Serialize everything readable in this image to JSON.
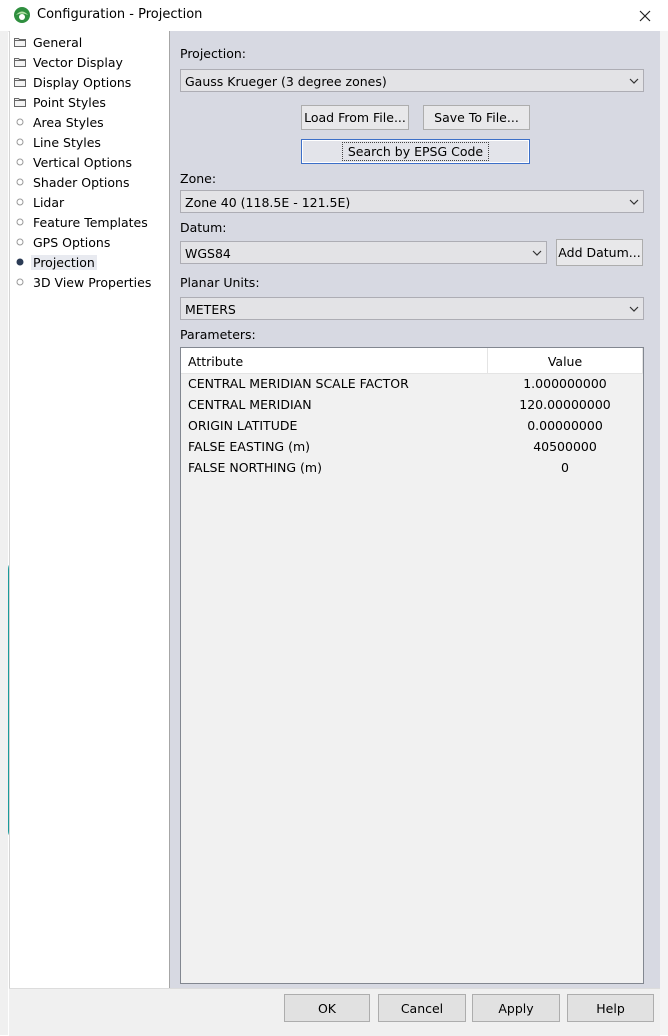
{
  "window": {
    "title": "Configuration - Projection"
  },
  "sidebar": {
    "items": [
      {
        "label": "General",
        "icon": "folder-icon"
      },
      {
        "label": "Vector Display",
        "icon": "folder-icon"
      },
      {
        "label": "Display Options",
        "icon": "folder-icon"
      },
      {
        "label": "Point Styles",
        "icon": "folder-icon"
      },
      {
        "label": "Area Styles",
        "icon": "circle-icon"
      },
      {
        "label": "Line Styles",
        "icon": "circle-icon"
      },
      {
        "label": "Vertical Options",
        "icon": "circle-icon"
      },
      {
        "label": "Shader Options",
        "icon": "circle-icon"
      },
      {
        "label": "Lidar",
        "icon": "circle-icon"
      },
      {
        "label": "Feature Templates",
        "icon": "circle-icon"
      },
      {
        "label": "GPS Options",
        "icon": "circle-icon"
      },
      {
        "label": "Projection",
        "icon": "filled-circle-icon",
        "selected": true
      },
      {
        "label": "3D View Properties",
        "icon": "circle-icon"
      }
    ]
  },
  "projection": {
    "label": "Projection:",
    "value": "Gauss Krueger (3 degree zones)",
    "load_button": "Load From File...",
    "save_button": "Save To File...",
    "epsg_button": "Search by EPSG Code"
  },
  "zone": {
    "label": "Zone:",
    "value": "Zone 40 (118.5E - 121.5E)"
  },
  "datum": {
    "label": "Datum:",
    "value": "WGS84",
    "add_button": "Add Datum..."
  },
  "planar_units": {
    "label": "Planar Units:",
    "value": "METERS"
  },
  "parameters": {
    "label": "Parameters:",
    "columns": [
      "Attribute",
      "Value"
    ],
    "rows": [
      {
        "attribute": "CENTRAL MERIDIAN SCALE FACTOR",
        "value": "1.000000000"
      },
      {
        "attribute": "CENTRAL MERIDIAN",
        "value": "120.00000000"
      },
      {
        "attribute": "ORIGIN LATITUDE",
        "value": "0.00000000"
      },
      {
        "attribute": "FALSE EASTING (m)",
        "value": "40500000"
      },
      {
        "attribute": "FALSE NORTHING (m)",
        "value": "0"
      }
    ]
  },
  "footer": {
    "ok": "OK",
    "cancel": "Cancel",
    "apply": "Apply",
    "help": "Help"
  },
  "colors": {
    "panel": "#d7d9e2",
    "focus_border": "#3c6fc8"
  }
}
